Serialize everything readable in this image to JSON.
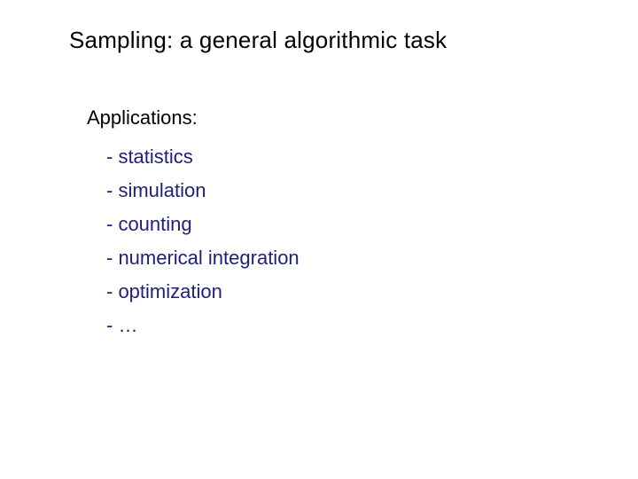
{
  "slide": {
    "title": "Sampling: a general algorithmic task",
    "subheading": "Applications:",
    "items": [
      "- statistics",
      "- simulation",
      "- counting",
      "- numerical integration",
      "- optimization",
      "- …"
    ]
  },
  "colors": {
    "item_text": "#1f1f7a",
    "heading_text": "#000000"
  }
}
